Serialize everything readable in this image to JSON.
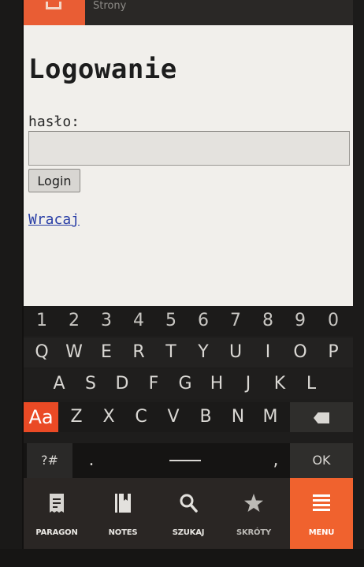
{
  "statusbar": {
    "title_fragment": "Strony"
  },
  "page": {
    "title": "Logowanie",
    "password_label": "hasło:",
    "password_value": "",
    "login_button": "Login",
    "back_link": "Wracaj"
  },
  "keyboard": {
    "digits": [
      "1",
      "2",
      "3",
      "4",
      "5",
      "6",
      "7",
      "8",
      "9",
      "0"
    ],
    "row_q": [
      "Q",
      "W",
      "E",
      "R",
      "T",
      "Y",
      "U",
      "I",
      "O",
      "P"
    ],
    "row_a": [
      "A",
      "S",
      "D",
      "F",
      "G",
      "H",
      "J",
      "K",
      "L"
    ],
    "shift": "Aa",
    "row_z": [
      "Z",
      "X",
      "C",
      "V",
      "B",
      "N",
      "M"
    ],
    "symbols": "?#",
    "period": ".",
    "comma": ",",
    "ok": "OK"
  },
  "nav": {
    "items": [
      {
        "label": "PARAGON",
        "icon": "receipt-icon"
      },
      {
        "label": "NOTES",
        "icon": "notebook-icon"
      },
      {
        "label": "SZUKAJ",
        "icon": "search-icon"
      },
      {
        "label": "SKRÓTY",
        "icon": "star-icon"
      },
      {
        "label": "MENU",
        "icon": "hamburger-icon"
      }
    ]
  },
  "colors": {
    "accent": "#f0622e",
    "shift_key": "#ea4a25",
    "link": "#2a3fa6",
    "page_background": "#f1efeb"
  }
}
